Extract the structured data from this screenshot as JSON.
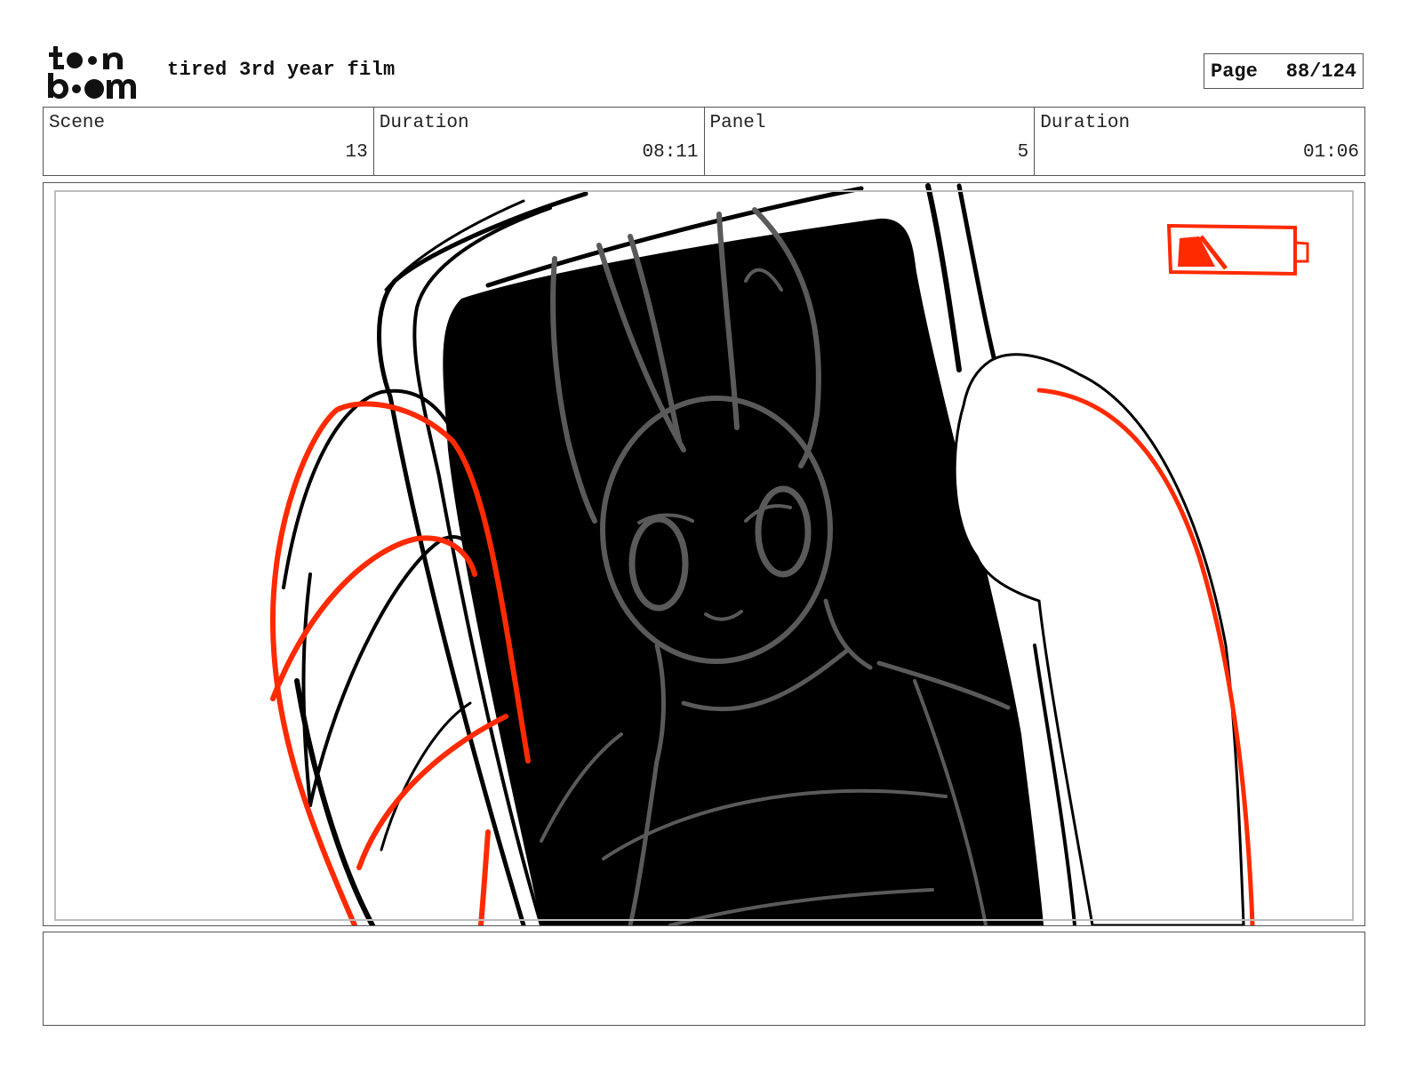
{
  "header": {
    "logo_text": "toon boom",
    "project_title": "tired 3rd year film",
    "page_label": "Page",
    "page_number": "88/124"
  },
  "info": {
    "scene_label": "Scene",
    "scene_value": "13",
    "scene_duration_label": "Duration",
    "scene_duration_value": "08:11",
    "panel_label": "Panel",
    "panel_value": "5",
    "panel_duration_label": "Duration",
    "panel_duration_value": "01:06"
  },
  "panel_image": {
    "icon": "battery-low-icon",
    "colors": {
      "sketch_black": "#000000",
      "sketch_red": "#ff2a00",
      "sketch_grey": "#5a5a5a"
    }
  },
  "notes": {
    "text": ""
  }
}
